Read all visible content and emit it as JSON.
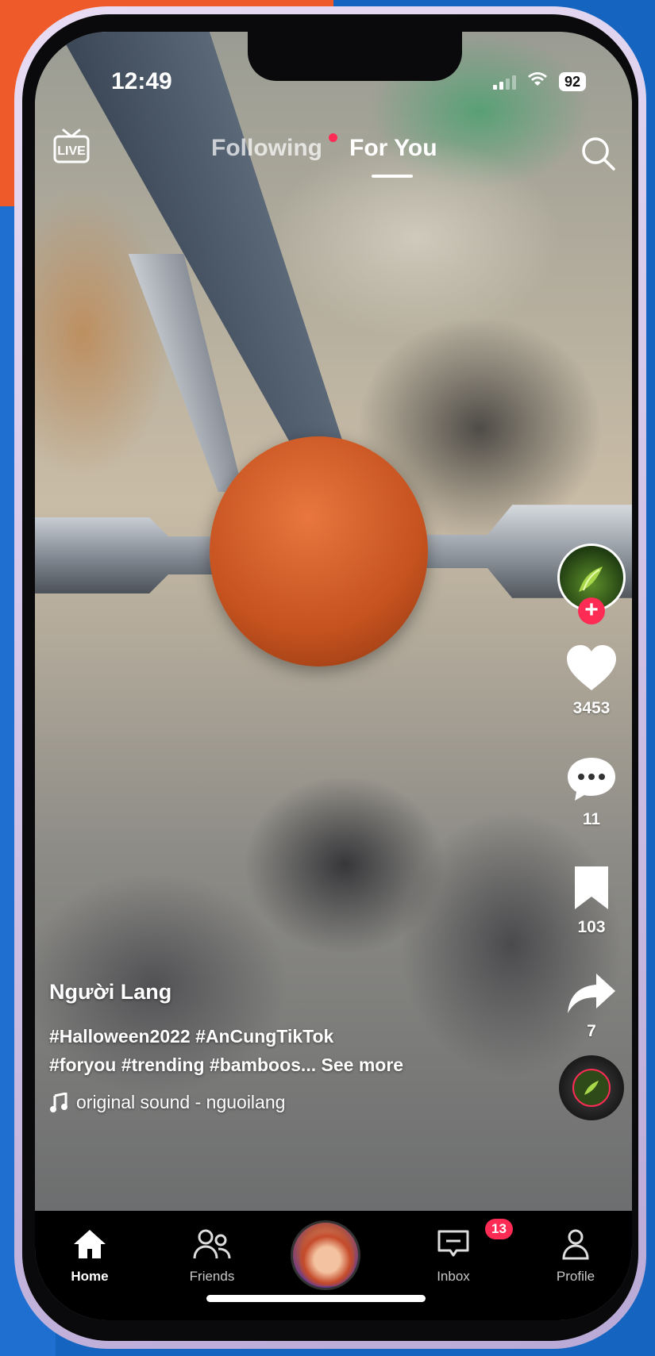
{
  "status_bar": {
    "time": "12:49",
    "battery": "92"
  },
  "top_bar": {
    "live_label": "LIVE",
    "tabs": [
      {
        "label": "Following"
      },
      {
        "label": "For You"
      }
    ]
  },
  "actions": {
    "likes": "3453",
    "comments": "11",
    "bookmarks": "103",
    "shares": "7"
  },
  "caption": {
    "username": "Người Lang",
    "line1": "#Halloween2022 #AnCungTikTok",
    "line2": "#foryou #trending #bamboos...",
    "see_more": "See more",
    "sound": "original sound - nguoilang"
  },
  "nav": {
    "home": "Home",
    "friends": "Friends",
    "inbox": "Inbox",
    "inbox_badge": "13",
    "profile": "Profile"
  },
  "colors": {
    "accent": "#fe2c55",
    "nav_bg": "#000000"
  }
}
